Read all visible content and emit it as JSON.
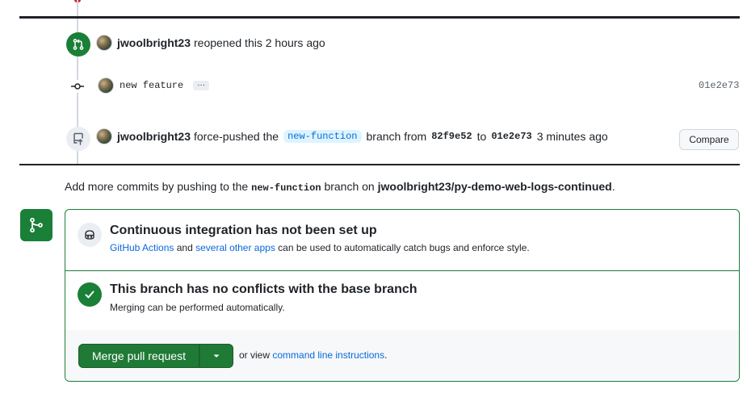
{
  "timeline": {
    "reopened": {
      "user": "jwoolbright23",
      "action": "reopened this",
      "time": "2 hours ago"
    },
    "commit": {
      "message": "new feature",
      "ellipsis": "···",
      "sha": "01e2e73"
    },
    "force_push": {
      "user": "jwoolbright23",
      "action_prefix": "force-pushed the",
      "branch": "new-function",
      "action_mid": "branch from",
      "from_sha": "82f9e52",
      "to_word": "to",
      "to_sha": "01e2e73",
      "time": "3 minutes ago",
      "compare_label": "Compare"
    }
  },
  "hint": {
    "prefix": "Add more commits by pushing to the",
    "branch": "new-function",
    "middle": "branch on",
    "repo": "jwoolbright23/py-demo-web-logs-continued",
    "suffix": "."
  },
  "merge_box": {
    "ci": {
      "title": "Continuous integration has not been set up",
      "link1": "GitHub Actions",
      "and": "and",
      "link2": "several other apps",
      "rest": "can be used to automatically catch bugs and enforce style."
    },
    "conflicts": {
      "title": "This branch has no conflicts with the base branch",
      "subtitle": "Merging can be performed automatically."
    },
    "actions": {
      "merge_label": "Merge pull request",
      "or_view": "or view",
      "cli_link": "command line instructions",
      "period": "."
    }
  },
  "colors": {
    "success": "#1a7f37",
    "link": "#0969da",
    "text": "#1f2328"
  }
}
